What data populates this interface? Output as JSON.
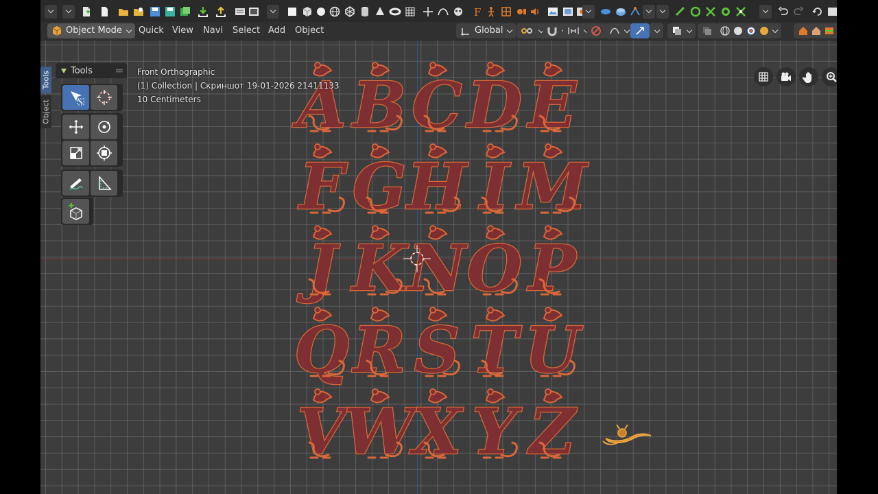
{
  "header": {
    "mode_label": "Object Mode",
    "menu": [
      "Quick",
      "View",
      "Navi",
      "Select",
      "Add",
      "Object"
    ],
    "transform_orientation": "Global"
  },
  "side_tabs": [
    "Tools",
    "Object"
  ],
  "tools_panel": {
    "title": "Tools"
  },
  "overlay": {
    "view_name": "Front Orthographic",
    "collection_line": "(1) Collection | Скриншот 19-01-2026 21411133",
    "scale": "10 Centimeters"
  },
  "colors": {
    "letter_fill": "#7e2f31",
    "letter_outline": "#d9683a",
    "grid_line": "#787878",
    "viewport_bg": "#3d3d3d",
    "x_axis": "#8a3a3a",
    "z_axis": "#2f5f9a",
    "active_tool": "#4772b3"
  },
  "icons": {
    "toolbar": [
      "chevron-down-icon",
      "chevron-down-icon",
      "new-file-icon",
      "open-folder-icon",
      "save-icon",
      "import-icon",
      "export-icon",
      "render-icon",
      "mesh-primitives-icon",
      "modifier-icon",
      "shading-icon",
      "undo-icon",
      "redo-icon"
    ],
    "nav": [
      "grid-icon",
      "camera-icon",
      "hand-pan-icon",
      "zoom-icon"
    ],
    "tools": [
      "select-box-icon",
      "cursor-icon",
      "move-icon",
      "rotate-icon",
      "scale-icon",
      "transform-icon",
      "annotate-icon",
      "measure-icon",
      "add-cube-icon"
    ]
  },
  "rat_alphabet": {
    "rows": [
      [
        "A",
        "B",
        "C",
        "D",
        "E"
      ],
      [
        "F",
        "G",
        "H",
        "I",
        "M"
      ],
      [
        "J",
        "K",
        "N",
        "O",
        "P"
      ],
      [
        "Q",
        "R",
        "S",
        "T",
        "U"
      ],
      [
        "V",
        "W",
        "X",
        "Y",
        "Z"
      ]
    ]
  }
}
